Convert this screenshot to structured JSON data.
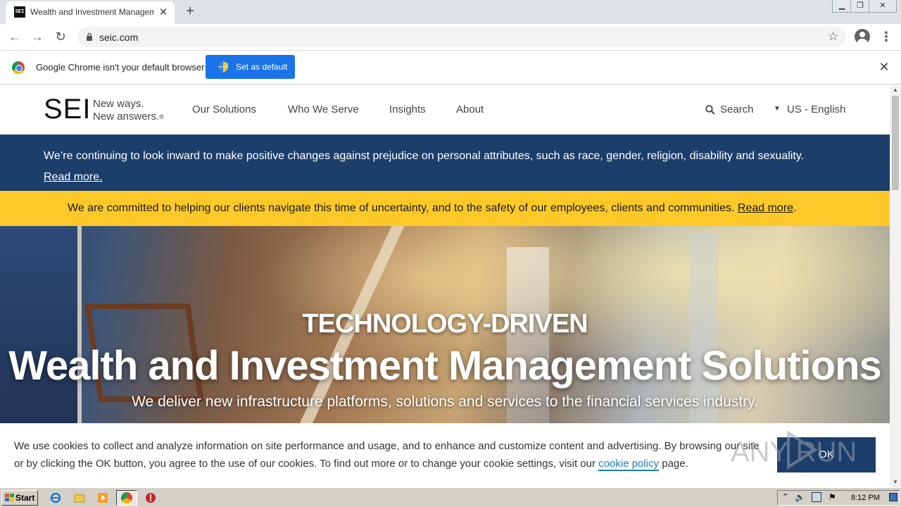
{
  "browser": {
    "tab_title": "Wealth and Investment Management",
    "tab_favicon_text": "SEI",
    "url": "seic.com"
  },
  "infobar": {
    "message": "Google Chrome isn't your default browser",
    "button_label": "Set as default"
  },
  "site": {
    "logo": "SEI",
    "tagline_line1": "New ways.",
    "tagline_line2": "New answers.",
    "tagline_mark": "®",
    "nav": [
      "Our Solutions",
      "Who We Serve",
      "Insights",
      "About"
    ],
    "search_label": "Search",
    "locale_label": "US - English"
  },
  "announcements": {
    "blue_text": "We’re continuing to look inward to make positive changes against prejudice on personal attributes, such as race, gender, religion, disability and sexuality.",
    "blue_link": "Read more.",
    "yellow_text": "We are committed to helping our clients navigate this time of uncertainty, and to the safety of our employees, clients and communities.",
    "yellow_link": "Read more",
    "yellow_suffix": "."
  },
  "hero": {
    "eyebrow": "TECHNOLOGY-DRIVEN",
    "title": "Wealth and Investment Management Solutions",
    "subtitle": "We deliver new infrastructure platforms, solutions and services to the financial services industry."
  },
  "cookie": {
    "text_before": "We use cookies to collect and analyze information on site performance and usage, and to enhance and customize content and advertising. By browsing our site or by clicking the OK button, you agree to the use of our cookies. To find out more or to change your cookie settings, visit our",
    "link": "cookie policy",
    "text_after": "page.",
    "ok_label": "OK"
  },
  "watermark": "ANY RUN",
  "taskbar": {
    "start_label": "Start",
    "clock": "8:12 PM"
  },
  "colors": {
    "sei_navy": "#1c3e6b",
    "sei_yellow": "#fdc928",
    "chrome_blue": "#1a73e8"
  }
}
